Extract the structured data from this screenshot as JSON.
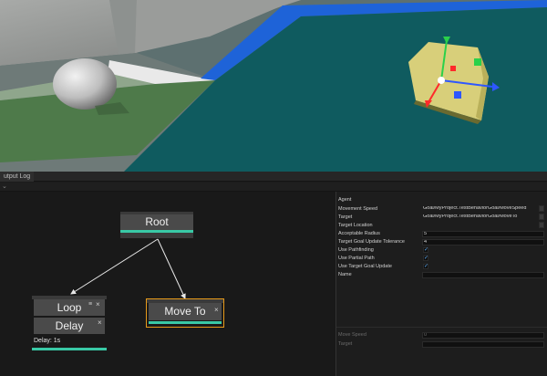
{
  "output_log_tab": "utput Log",
  "graph": {
    "nodes": {
      "root": {
        "title": "Root"
      },
      "loop": {
        "title": "Loop",
        "eq_icon": "≡",
        "close": "×"
      },
      "delay": {
        "title": "Delay",
        "close": "×",
        "info": "Delay: 1s"
      },
      "move_to": {
        "title": "Move To",
        "close": "×"
      }
    }
  },
  "properties": {
    "agent_label": "Agent",
    "rows": [
      {
        "label": "Movement Speed",
        "value": "Goal/MyProject.TestBehaviorGoal/MoveSpeed"
      },
      {
        "label": "Target",
        "value": "Goal/MyProject.TestBehaviorGoal/MoveTo"
      },
      {
        "label": "Target Location",
        "value": ""
      },
      {
        "label": "Acceptable Radius",
        "value": "5"
      },
      {
        "label": "Target Goal Update Tolerance",
        "value": "4"
      }
    ],
    "checks": [
      {
        "label": "Use Pathfinding",
        "checked": true
      },
      {
        "label": "Use Partial Path",
        "checked": true
      },
      {
        "label": "Use Target Goal Update",
        "checked": true
      }
    ],
    "name_label": "Name",
    "goal": [
      {
        "label": "Move Speed",
        "value": "0"
      },
      {
        "label": "Target",
        "value": ""
      }
    ]
  },
  "colors": {
    "node_accent": "#39c9a6",
    "selected_outline": "#e89b1a",
    "check_blue": "#5fb3ff",
    "floor_teal": "#0f5b5f",
    "floor_edge_blue": "#1e63d8"
  }
}
